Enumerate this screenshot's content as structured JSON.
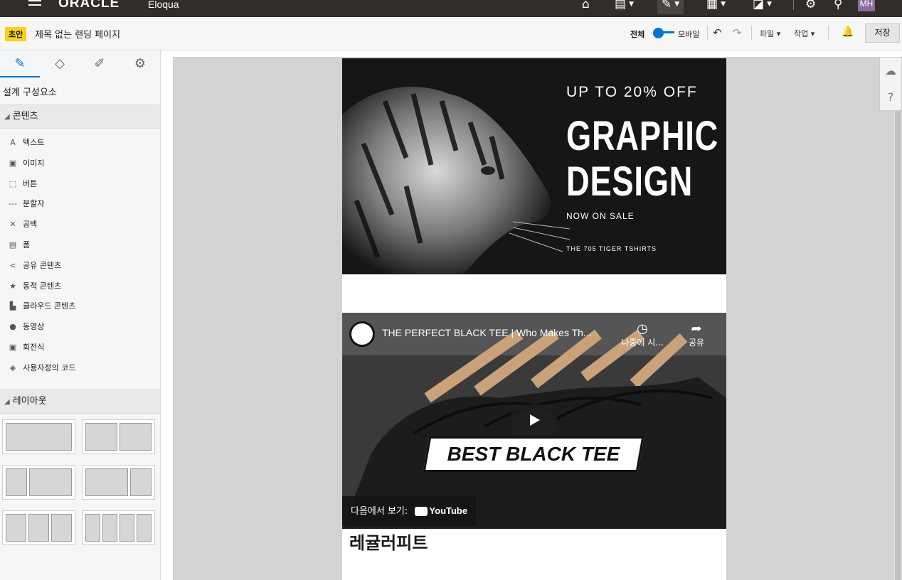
{
  "topbar": {
    "brand": "ORACLE",
    "app_name": "Eloqua",
    "user_initials": "MH"
  },
  "subbar": {
    "status_badge": "초안",
    "page_title": "제목 없는 랜딩 페이지",
    "view_full": "전체",
    "view_mobile": "모바일",
    "file_menu": "파일",
    "actions_menu": "작업",
    "save": "저장"
  },
  "left_panel": {
    "heading": "설계 구성요소",
    "content_section": "콘텐츠",
    "layout_section": "레이아웃",
    "items": [
      {
        "icon": "text-icon",
        "glyph": "A",
        "label": "텍스트"
      },
      {
        "icon": "image-icon",
        "glyph": "▣",
        "label": "이미지"
      },
      {
        "icon": "button-icon",
        "glyph": "⬚",
        "label": "버튼"
      },
      {
        "icon": "divider-icon",
        "glyph": "---",
        "label": "분할자"
      },
      {
        "icon": "spacer-icon",
        "glyph": "✕",
        "label": "공백"
      },
      {
        "icon": "form-icon",
        "glyph": "▤",
        "label": "폼"
      },
      {
        "icon": "share-icon",
        "glyph": "<",
        "label": "공유 콘텐츠"
      },
      {
        "icon": "star-icon",
        "glyph": "★",
        "label": "동적 콘텐츠"
      },
      {
        "icon": "cloud-doc-icon",
        "glyph": "▙",
        "label": "클라우드 콘텐츠"
      },
      {
        "icon": "video-icon",
        "glyph": "●",
        "label": "동영상"
      },
      {
        "icon": "carousel-icon",
        "glyph": "▣",
        "label": "회전식"
      },
      {
        "icon": "code-icon",
        "glyph": "◈",
        "label": "사용자정의 코드"
      }
    ]
  },
  "hero": {
    "offer": "UP TO 20% OFF",
    "headline_1": "GRAPHIC",
    "headline_2": "DESIGN",
    "subline": "NOW ON SALE",
    "tagline": "THE 705 TIGER TSHIRTS"
  },
  "video": {
    "title": "THE PERFECT BLACK TEE | Who Makes Th...",
    "watch_later": "나중에 시...",
    "share": "공유",
    "banner": "BEST BLACK TEE",
    "watch_on": "다음에서 보기:",
    "yt_brand": "YouTube"
  },
  "section_heading": "레귤러피트"
}
